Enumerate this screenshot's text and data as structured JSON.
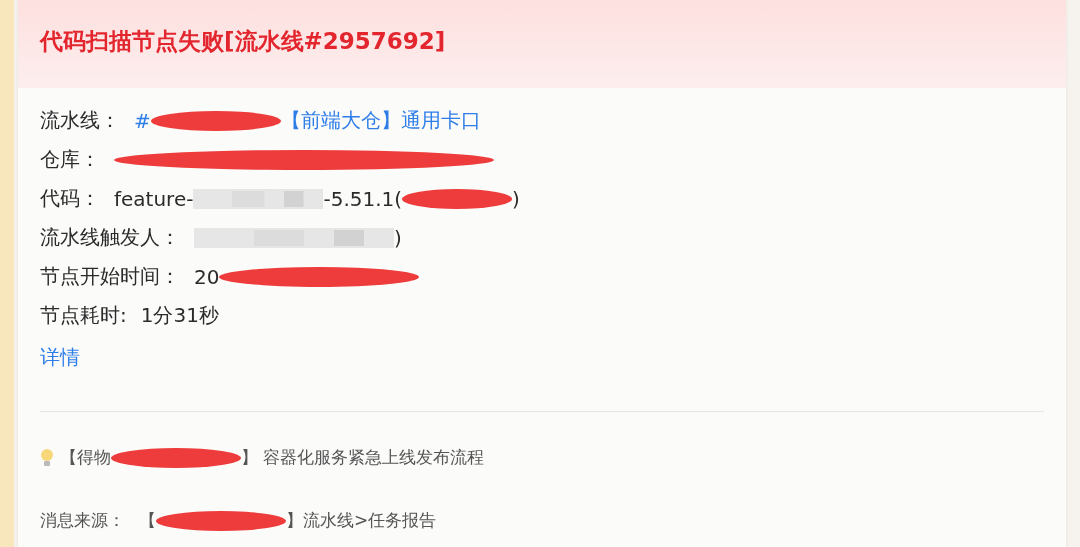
{
  "card": {
    "title": "代码扫描节点失败[流水线#2957692]",
    "fields": [
      {
        "label": "流水线：",
        "parts": [
          {
            "kind": "link",
            "text": "#"
          },
          {
            "kind": "redacted"
          },
          {
            "kind": "link",
            "text": "【前端大仓】通用卡口"
          }
        ]
      },
      {
        "label": "仓库：",
        "parts": [
          {
            "kind": "redacted_long"
          }
        ]
      },
      {
        "label": "代码：",
        "parts": [
          {
            "kind": "text",
            "text": "feature-"
          },
          {
            "kind": "blurred"
          },
          {
            "kind": "text",
            "text": "-5.51.1("
          },
          {
            "kind": "redacted_short"
          },
          {
            "kind": "text",
            "text": ")"
          }
        ]
      },
      {
        "label": "流水线触发人：",
        "parts": [
          {
            "kind": "blurred_long"
          },
          {
            "kind": "text",
            "text": ")"
          }
        ]
      },
      {
        "label": "节点开始时间：",
        "parts": [
          {
            "kind": "text",
            "text": "20"
          },
          {
            "kind": "redacted_wide"
          }
        ]
      },
      {
        "label": "节点耗时:",
        "parts": [
          {
            "kind": "text",
            "text": "1分31秒"
          }
        ]
      }
    ],
    "detail_link": "详情",
    "tip": {
      "parts": [
        {
          "kind": "text",
          "text": "【得物"
        },
        {
          "kind": "redacted"
        },
        {
          "kind": "text",
          "text": "】 容器化服务紧急上线发布流程"
        }
      ]
    },
    "source": {
      "label": "消息来源：",
      "parts": [
        {
          "kind": "text",
          "text": "【"
        },
        {
          "kind": "redacted"
        },
        {
          "kind": "text",
          "text": "】流水线>任务报告"
        }
      ]
    }
  }
}
